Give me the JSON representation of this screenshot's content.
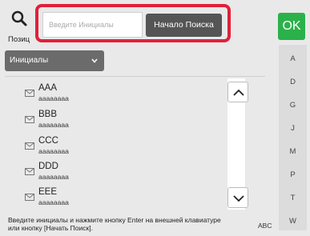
{
  "search": {
    "placeholder": "Введите Инициалы",
    "button_label": "Начало Поиска"
  },
  "ok_label": "OK",
  "position_label": "Позиц",
  "dropdown": {
    "selected": "Инициалы"
  },
  "entries": [
    {
      "name": "AAA",
      "sub": "aaaaaaaa"
    },
    {
      "name": "BBB",
      "sub": "aaaaaaaa"
    },
    {
      "name": "CCC",
      "sub": "aaaaaaaa"
    },
    {
      "name": "DDD",
      "sub": "aaaaaaaa"
    },
    {
      "name": "EEE",
      "sub": "aaaaaaaa"
    }
  ],
  "alphabet": [
    "A",
    "D",
    "G",
    "J",
    "M",
    "P",
    "T",
    "W"
  ],
  "hint": "Введите инициалы и нажмите кнопку Enter на внешней клавиатуре или кнопку [Начать Поиск].",
  "abc_label": "ABC",
  "colors": {
    "highlight": "#e0203a",
    "ok": "#2bb14a",
    "button": "#555555"
  }
}
